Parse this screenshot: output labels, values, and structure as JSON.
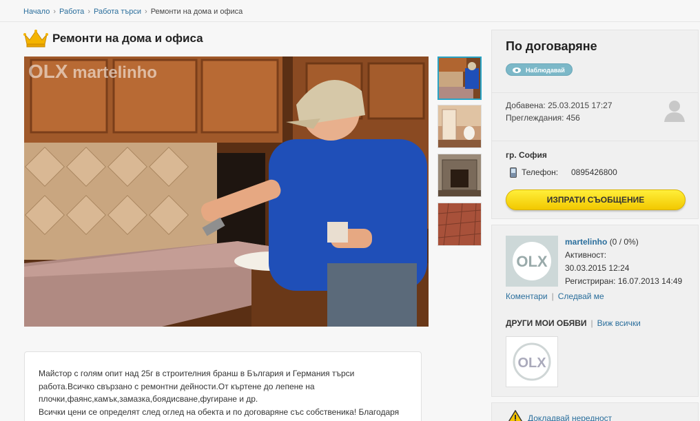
{
  "breadcrumb": [
    "Начало",
    "Работа",
    "Работа търси",
    "Ремонти на дома и офиса"
  ],
  "title": "Ремонти на дома и офиса",
  "watermark": {
    "olx": "OLX",
    "brand": "martelinho"
  },
  "description": {
    "line1": "Майстор с голям опит над 25г в строителния бранш в България и Германия търси",
    "line2": "работа.Всичко свързано с ремонтни дейности.От къртене до лепене на",
    "line3": "плочки,фаянс,камък,замазка,боядисване,фугиране и  др.",
    "line4": "Всички цени се определят след оглед на обекта и по договаряне със собственика! Благодаря"
  },
  "price": "По договаряне",
  "watch_label": "Наблюдавай",
  "meta": {
    "added": "Добавена: 25.03.2015 17:27",
    "views": "Преглеждания: 456"
  },
  "contact": {
    "city": "гр. София",
    "phone_label": "Телефон:",
    "phone": "0895426800",
    "send_label": "ИЗПРАТИ СЪОБЩЕНИЕ"
  },
  "user": {
    "name": "martelinho",
    "rating": "(0 / 0%)",
    "activity_label": "Активност:",
    "activity": "30.03.2015 12:24",
    "registered": "Регистриран: 16.07.2013 14:49",
    "comments": "Коментари",
    "follow": "Следвай ме",
    "other_ads": "ДРУГИ МОИ ОБЯВИ",
    "see_all": "Виж всички"
  },
  "report_label": "Докладвай нередност",
  "colors": {
    "link": "#2a6e9c",
    "accent": "#27a3c5",
    "button": "#f2c800"
  }
}
